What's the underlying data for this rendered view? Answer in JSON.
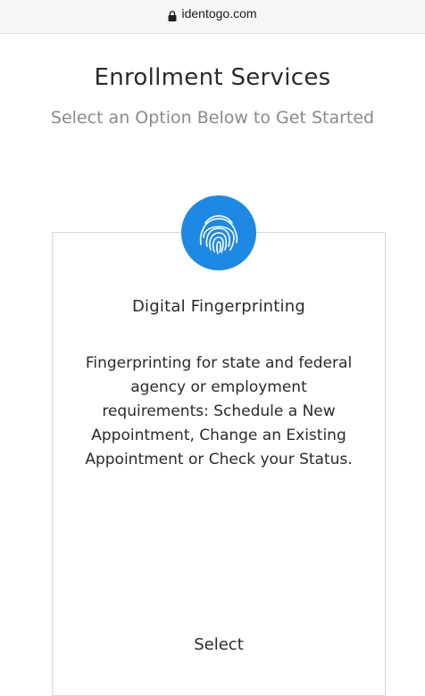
{
  "browser": {
    "url": "identogo.com",
    "lock_icon": "lock-icon"
  },
  "header": {
    "title": "Enrollment Services",
    "subtitle": "Select an Option Below to Get Started"
  },
  "service_card": {
    "icon": "fingerprint-icon",
    "icon_color": "#1e88e5",
    "title": "Digital Fingerprinting",
    "description": "Fingerprinting for state and federal agency or employment requirements: Schedule a New Appointment, Change an Existing Appointment or Check your Status.",
    "select_label": "Select"
  }
}
